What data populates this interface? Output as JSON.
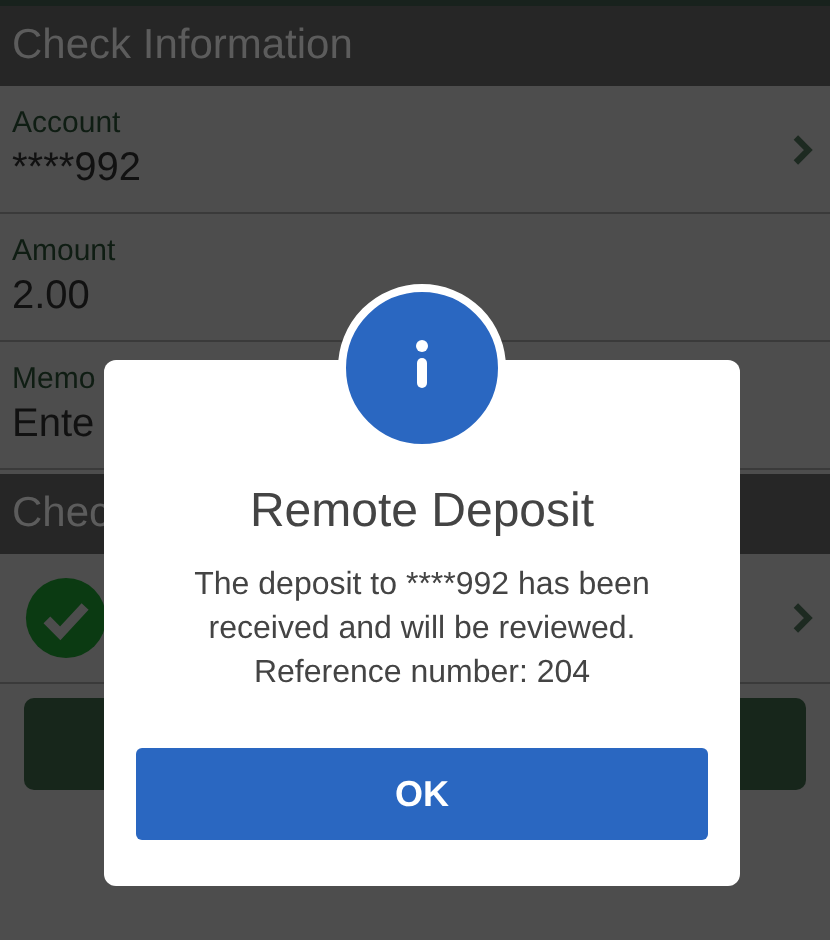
{
  "sections": [
    {
      "title": "Check Information",
      "fields": [
        {
          "label": "Account",
          "value": "****992",
          "chevron": true
        },
        {
          "label": "Amount",
          "value": "2.00",
          "chevron": false
        },
        {
          "label": "Memo",
          "value": "Ente",
          "chevron": false
        }
      ]
    },
    {
      "title": "Chec",
      "rows": [
        {
          "kind": "status",
          "checked": true,
          "chevron": true
        }
      ]
    }
  ],
  "dialog": {
    "title": "Remote Deposit",
    "message": [
      "The deposit to ****992 has been",
      "received and will be reviewed.",
      "Reference number: 204"
    ],
    "button": "OK"
  }
}
